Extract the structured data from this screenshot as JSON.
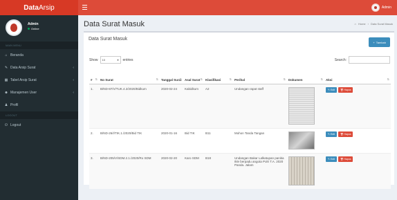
{
  "app": {
    "logo_bold": "Data",
    "logo_light": "Arsip"
  },
  "topbar": {
    "user_label": "Admin"
  },
  "sidebar": {
    "user_name": "Admin",
    "user_status": "Online",
    "section_main": "MAIN MENU",
    "items": [
      {
        "label": "Beranda",
        "icon": "home-icon",
        "has_submenu": false
      },
      {
        "label": "Data Arsip Surat",
        "icon": "edit-icon",
        "has_submenu": true
      },
      {
        "label": "Tabel Arsip Surat",
        "icon": "table-icon",
        "has_submenu": true
      },
      {
        "label": "Manajemen User",
        "icon": "users-icon",
        "has_submenu": true
      },
      {
        "label": "Profil",
        "icon": "user-icon",
        "has_submenu": false
      }
    ],
    "section_logout": "LOGOUT",
    "logout_label": "Logout"
  },
  "page": {
    "title": "Data Surat Masuk",
    "breadcrumb": [
      "Home",
      "Data Surat Masuk"
    ]
  },
  "box": {
    "title": "Data Surat Masuk",
    "add_button": "Tambah",
    "show_label": "Show",
    "entries_value": "10",
    "entries_label": "entries",
    "search_label": "Search:"
  },
  "table": {
    "headers": [
      "#",
      "No Surat",
      "Tanggal Surat",
      "Asal Surat",
      "Klasifikasi",
      "Perihal",
      "Dokumen",
      "Aksi"
    ],
    "rows": [
      {
        "num": "1.",
        "no_surat": "B/ND-87/V/TUK.4.2/2020/Bidkum",
        "tanggal": "2020-02-24",
        "asal": "Kabidkum",
        "klasifikasi": "A2",
        "perihal": "Undangan rapat staff"
      },
      {
        "num": "2.",
        "no_surat": "B/ND-26/I/TIK.1./2020/Bid TIK",
        "tanggal": "2020-01-16",
        "asal": "Bid TIK",
        "klasifikasi": "B11",
        "perihal": "Mohon Tanda Tangan"
      },
      {
        "num": "3.",
        "no_surat": "B/ND-205/V/SDM.2.1./2020/Ro SDM",
        "tanggal": "2020-02-20",
        "asal": "Karo SDM",
        "klasifikasi": "B18",
        "perihal": "Undangan Bakar Lalkatupan panitia Ikle berpadu angota Polri T.A. 2020 Panda. Jalam"
      }
    ],
    "edit_label": "Edit",
    "delete_label": "Hapus"
  },
  "colors": {
    "header_red": "#dd4b39",
    "logo_red": "#d73925",
    "sidebar_dark": "#222d32",
    "primary_blue": "#3c8dbc"
  }
}
